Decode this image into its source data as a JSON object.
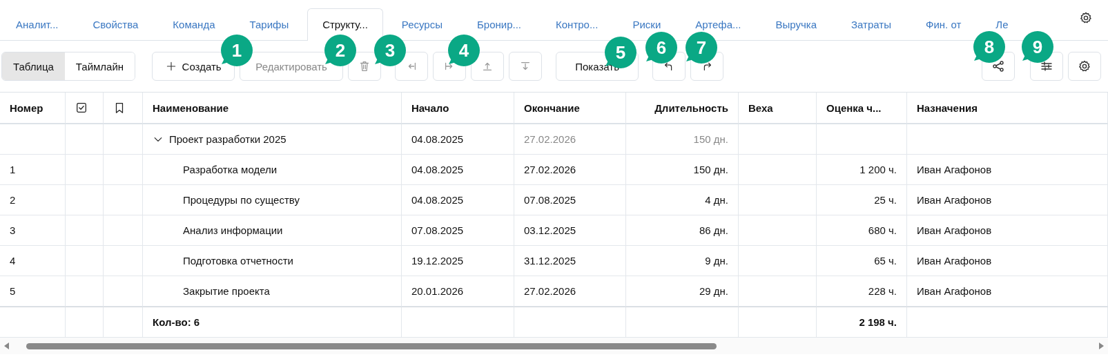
{
  "tabs": [
    {
      "label": "Аналит...",
      "selected": false
    },
    {
      "label": "Свойства",
      "selected": false
    },
    {
      "label": "Команда",
      "selected": false
    },
    {
      "label": "Тарифы",
      "selected": false
    },
    {
      "label": "Структу...",
      "selected": true
    },
    {
      "label": "Ресурсы",
      "selected": false
    },
    {
      "label": "Бронир...",
      "selected": false
    },
    {
      "label": "Контро...",
      "selected": false
    },
    {
      "label": "Риски",
      "selected": false
    },
    {
      "label": "Артефа...",
      "selected": false
    },
    {
      "label": "Выручка",
      "selected": false
    },
    {
      "label": "Затраты",
      "selected": false
    },
    {
      "label": "Фин. от",
      "selected": false
    },
    {
      "label": "Ле",
      "selected": false
    }
  ],
  "view_toggle": [
    {
      "label": "Таблица",
      "selected": true
    },
    {
      "label": "Таймлайн",
      "selected": false
    }
  ],
  "toolbar": {
    "create": "Создать",
    "edit": {
      "label": "Редактировать",
      "disabled": true
    },
    "show": "Показать"
  },
  "table": {
    "columns": [
      "Номер",
      "",
      "",
      "Наименование",
      "Начало",
      "Окончание",
      "Длительность",
      "Веха",
      "Оценка ч...",
      "Назначения"
    ],
    "rows": [
      {
        "kind": "summary",
        "expanded": true,
        "number": "",
        "name": "Проект разработки 2025",
        "start": "04.08.2025",
        "end": "27.02.2026",
        "duration": "150 дн.",
        "estimate": "",
        "assignee": ""
      },
      {
        "kind": "task",
        "number": "1",
        "name": "Разработка модели",
        "start": "04.08.2025",
        "end": "27.02.2026",
        "duration": "150 дн.",
        "estimate": "1 200 ч.",
        "assignee": "Иван Агафонов"
      },
      {
        "kind": "task",
        "number": "2",
        "name": "Процедуры по существу",
        "start": "04.08.2025",
        "end": "07.08.2025",
        "duration": "4 дн.",
        "estimate": "25 ч.",
        "assignee": "Иван Агафонов"
      },
      {
        "kind": "task",
        "number": "3",
        "name": "Анализ информации",
        "start": "07.08.2025",
        "end": "03.12.2025",
        "duration": "86 дн.",
        "estimate": "680 ч.",
        "assignee": "Иван Агафонов"
      },
      {
        "kind": "task",
        "number": "4",
        "name": "Подготовка отчетности",
        "start": "19.12.2025",
        "end": "31.12.2025",
        "duration": "9 дн.",
        "estimate": "65 ч.",
        "assignee": "Иван Агафонов"
      },
      {
        "kind": "task",
        "number": "5",
        "name": "Закрытие проекта",
        "start": "20.01.2026",
        "end": "27.02.2026",
        "duration": "29 дн.",
        "estimate": "228 ч.",
        "assignee": "Иван Агафонов"
      }
    ],
    "footer": {
      "count": "Кол-во: 6",
      "estimate_total": "2 198 ч."
    }
  },
  "callouts": [
    "1",
    "2",
    "3",
    "4",
    "5",
    "6",
    "7",
    "8",
    "9"
  ]
}
